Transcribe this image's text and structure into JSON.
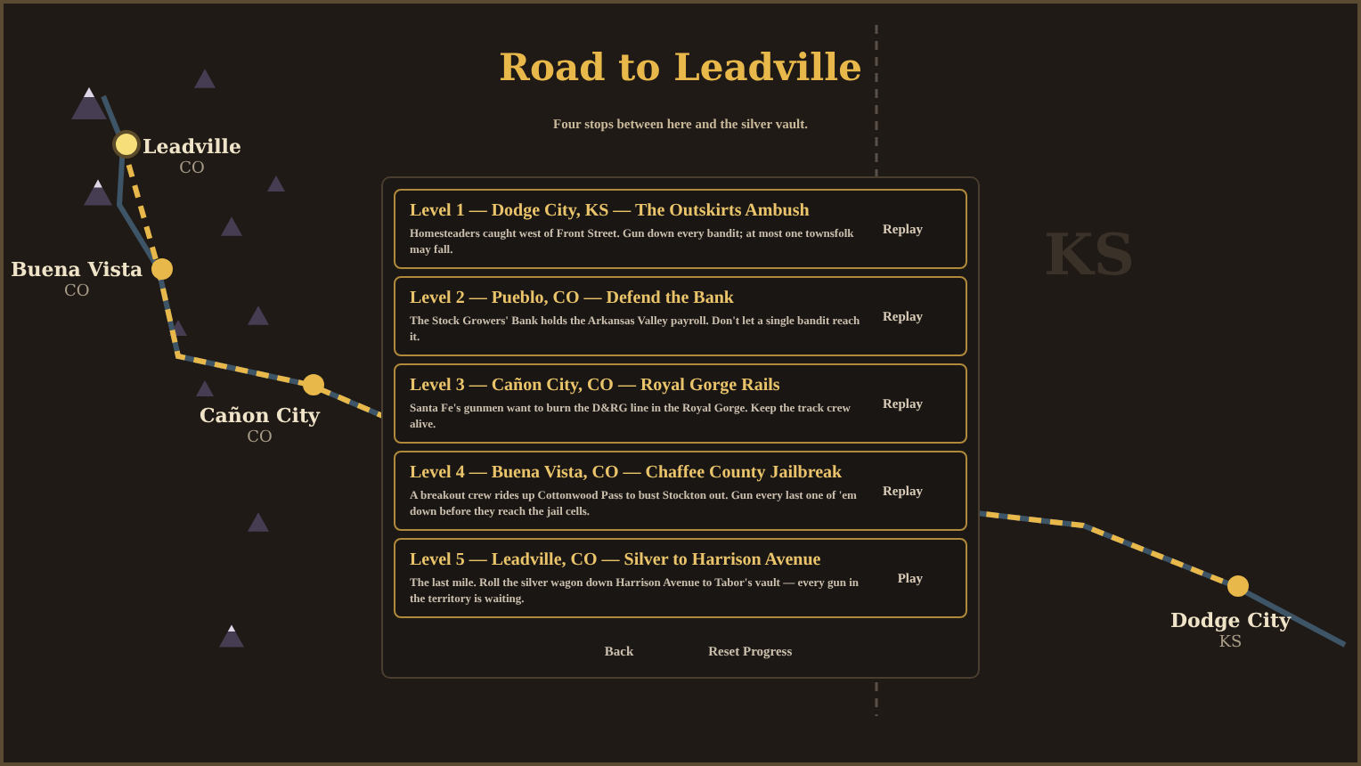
{
  "title": "Road to Leadville",
  "subtitle": "Four stops between here and the silver vault.",
  "map": {
    "region_label": "KS",
    "cities": [
      {
        "name": "Leadville",
        "state": "CO",
        "current": true
      },
      {
        "name": "Buena Vista",
        "state": "CO",
        "current": false
      },
      {
        "name": "Cañon City",
        "state": "CO",
        "current": false
      },
      {
        "name": "Dodge City",
        "state": "KS",
        "current": false
      }
    ]
  },
  "levels": [
    {
      "title": "Level 1 — Dodge City, KS — The Outskirts Ambush",
      "description": "Homesteaders caught west of Front Street. Gun down every bandit; at most one townsfolk may fall.",
      "action": "Replay"
    },
    {
      "title": "Level 2 — Pueblo, CO — Defend the Bank",
      "description": "The Stock Growers' Bank holds the Arkansas Valley payroll. Don't let a single bandit reach it.",
      "action": "Replay"
    },
    {
      "title": "Level 3 — Cañon City, CO — Royal Gorge Rails",
      "description": "Santa Fe's gunmen want to burn the D&RG line in the Royal Gorge. Keep the track crew alive.",
      "action": "Replay"
    },
    {
      "title": "Level 4 — Buena Vista, CO — Chaffee County Jailbreak",
      "description": "A breakout crew rides up Cottonwood Pass to bust Stockton out. Gun every last one of 'em down before they reach the jail cells.",
      "action": "Replay"
    },
    {
      "title": "Level 5 — Leadville, CO — Silver to Harrison Avenue",
      "description": "The last mile. Roll the silver wagon down Harrison Avenue to Tabor's vault — every gun in the territory is waiting.",
      "action": "Play"
    }
  ],
  "buttons": [
    "Back",
    "Reset Progress"
  ]
}
